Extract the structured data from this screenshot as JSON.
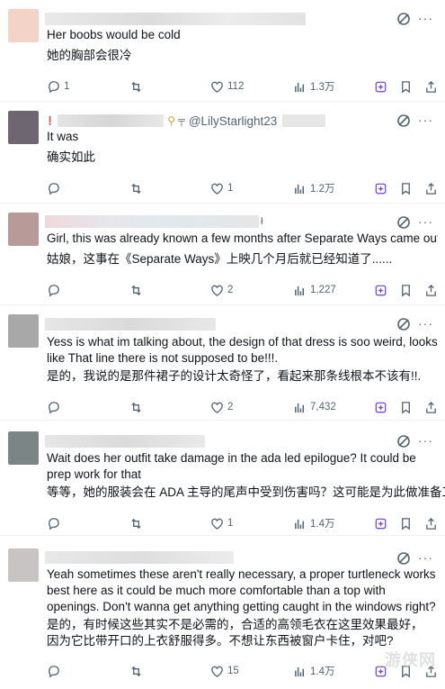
{
  "posts": [
    {
      "handle": "",
      "text": "Her boobs would be cold",
      "translation": "她的胸部会很冷",
      "reply_count": "1",
      "like_count": "112",
      "view_count": "1.3万",
      "avatar_color": "#f3d3c8"
    },
    {
      "handle": "@LilyStarlight23",
      "text": "It was",
      "translation": "确实如此",
      "reply_count": "",
      "like_count": "1",
      "view_count": "1.2万",
      "avatar_color": "#6e6670"
    },
    {
      "handle": "",
      "text": "Girl, this was already known a few months after Separate Ways came out...",
      "translation": "姑娘，这事在《Separate Ways》上映几个月后就已经知道了......",
      "reply_count": "",
      "like_count": "2",
      "view_count": "1,227",
      "avatar_color": "#b89a99"
    },
    {
      "handle": "",
      "text": "Yess is what im talking about, the design of that dress is soo weird, looks like That line there is not supposed to be!!!.",
      "translation": "是的，我说的是那件裙子的设计太奇怪了，看起来那条线根本不该有!!.",
      "reply_count": "",
      "like_count": "2",
      "view_count": "7,432",
      "avatar_color": "#a8a8a8"
    },
    {
      "handle": "",
      "text": "Wait does her outfit take damage in the ada led epilogue? It could be prep work for that",
      "translation": "等等，她的服装会在 ADA 主导的尾声中受到伤害吗？这可能是为此做准备工作",
      "reply_count": "",
      "like_count": "1",
      "view_count": "1.4万",
      "avatar_color": "#7a8584"
    },
    {
      "handle": "",
      "text": "Yeah sometimes these aren't really necessary, a proper turtleneck works best here as it could be much more comfortable than a top with openings. Don't wanna get anything getting caught in the windows right?",
      "translation": "是的，有时候这些其实不是必需的，合适的高领毛衣在这里效果最好，因为它比带开口的上衣舒服得多。不想让东西被窗户卡住，对吧?",
      "reply_count": "",
      "like_count": "15",
      "view_count": "1.4万",
      "avatar_color": "#c9c4c4"
    }
  ],
  "watermark": "游侠网",
  "colors": {
    "accent": "#7b4fd8",
    "muted": "#536471",
    "text": "#0f1419"
  }
}
